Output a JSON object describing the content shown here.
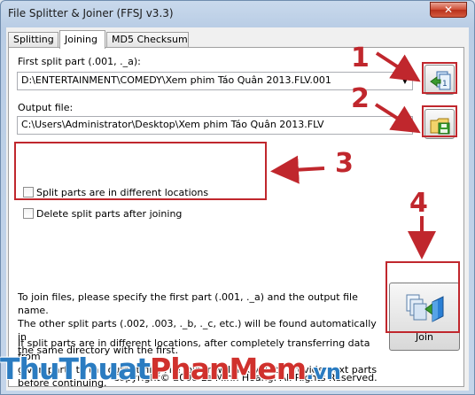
{
  "window": {
    "title": "File Splitter & Joiner (FFSJ v3.3)",
    "close_label": "✕"
  },
  "tabs": [
    {
      "label": "Splitting",
      "active": false
    },
    {
      "label": "Joining",
      "active": true
    },
    {
      "label": "MD5 Checksum",
      "active": false
    }
  ],
  "first_part": {
    "label": "First split part (.001, ._a):",
    "value": "D:\\ENTERTAINMENT\\COMEDY\\Xem phim Táo Quân 2013.FLV.001"
  },
  "output": {
    "label": "Output file:",
    "value": "C:\\Users\\Administrator\\Desktop\\Xem phim Táo Quân 2013.FLV"
  },
  "options": {
    "different_locations": {
      "label": "Split parts are in different locations",
      "checked": false
    },
    "delete_after": {
      "label": "Delete split parts after joining",
      "checked": false
    }
  },
  "help": {
    "paragraph1": [
      "To join files, please specify the first part (.001, ._a) and the output file name.",
      "The other split parts (.002, .003, ._b, ._c, etc.) will be found automatically in",
      "the same directory with the first."
    ],
    "paragraph2": [
      "If split parts are in different locations, after completely transferring data from",
      "given parts to the output file, File Joiner will ask you to provide next parts",
      "before continuing."
    ]
  },
  "join_button": {
    "label": "Join",
    "accesskey": "J"
  },
  "footer": {
    "copyright": "Copyright© 2008 Le Minh Hoang. All Rights Reserved."
  },
  "annotations": [
    "1",
    "2",
    "3",
    "4"
  ],
  "watermark": {
    "part1": "ThuThuat",
    "part2": "PhanMem",
    "part3": ".vn"
  },
  "colors": {
    "annotation_red": "#c0272d",
    "watermark_blue": "#2b7cc1",
    "watermark_red": "#d0312d"
  }
}
